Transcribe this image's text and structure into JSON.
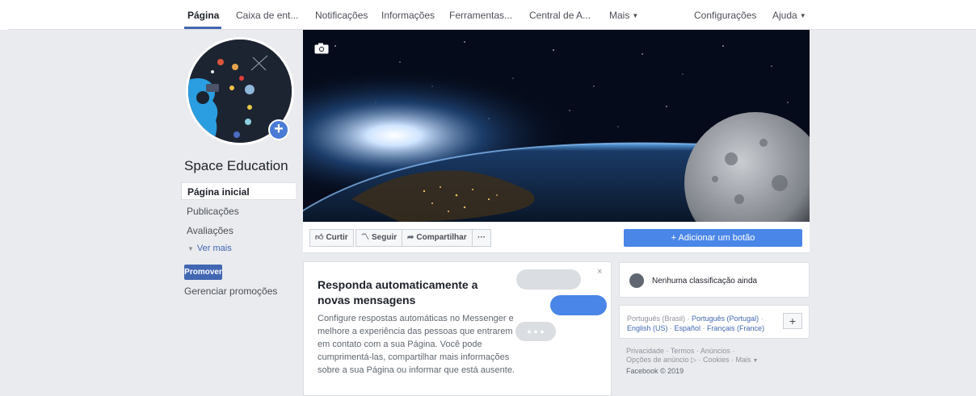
{
  "topnav": {
    "tabs": [
      {
        "label": "Página"
      },
      {
        "label": "Caixa de ent..."
      },
      {
        "label": "Notificações"
      },
      {
        "label": "Informações"
      },
      {
        "label": "Ferramentas..."
      },
      {
        "label": "Central de A..."
      },
      {
        "label": "Mais"
      },
      {
        "label": "Configurações"
      },
      {
        "label": "Ajuda"
      }
    ]
  },
  "page": {
    "name": "Space Education"
  },
  "leftnav": {
    "items": [
      {
        "label": "Página inicial"
      },
      {
        "label": "Publicações"
      },
      {
        "label": "Avaliações"
      }
    ],
    "see_more": "Ver mais",
    "promote": "Promover",
    "manage_promotions": "Gerenciar promoções"
  },
  "actions": {
    "like": "Curtir",
    "follow": "Seguir",
    "share": "Compartilhar",
    "more": "···",
    "add_button": "+ Adicionar um botão"
  },
  "auto_reply": {
    "title": "Responda automaticamente a novas mensagens",
    "body": "Configure respostas automáticas no Messenger e melhore a experiência das pessoas que entrarem em contato com a sua Página. Você pode cumprimentá-las, compartilhar mais informações sobre a sua Página ou informar que está ausente.",
    "close": "×"
  },
  "rating": {
    "text": "Nenhuma classificação ainda"
  },
  "languages": {
    "current": "Português (Brasil)",
    "links": [
      "Português (Portugal)",
      "English (US)",
      "Español",
      "Français (France)"
    ],
    "add": "+"
  },
  "footer": {
    "links": [
      "Privacidade",
      "Termos",
      "Anúncios",
      "Opções de anúncio",
      "Cookies",
      "Mais"
    ],
    "copyright": "Facebook © 2019"
  },
  "colors": {
    "brand": "#4267b2",
    "button_blue": "#4a86e8"
  }
}
